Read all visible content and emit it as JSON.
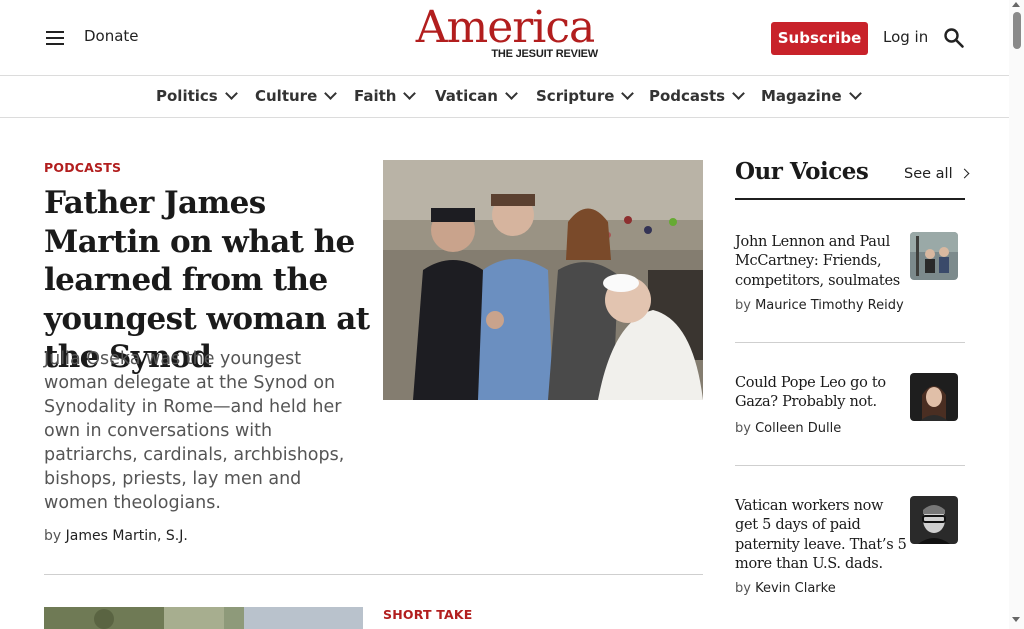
{
  "header": {
    "donate": "Donate",
    "logo_word": "America",
    "logo_sub": "THE JESUIT REVIEW",
    "subscribe": "Subscribe",
    "login": "Log in",
    "menu_icon": "hamburger-menu-icon",
    "search_icon": "search-icon"
  },
  "nav": {
    "items": [
      {
        "label": "Politics"
      },
      {
        "label": "Culture"
      },
      {
        "label": "Faith"
      },
      {
        "label": "Vatican"
      },
      {
        "label": "Scripture"
      },
      {
        "label": "Podcasts"
      },
      {
        "label": "Magazine"
      }
    ]
  },
  "main": {
    "kicker": "PODCASTS",
    "headline": "Father James Martin on what he learned from the youngest woman at the Synod",
    "dek": "Julia Oseka was the youngest woman delegate at the Synod on Synodality in Rome—and held her own in conversations with patriarchs, cardinals, archbishops, bishops, priests, lay men and women theologians.",
    "by_prefix": "by",
    "author": "James Martin, S.J.",
    "next_kicker": "SHORT TAKE"
  },
  "sidebar": {
    "title": "Our Voices",
    "see_all": "See all",
    "items": [
      {
        "title": "John Lennon and Paul McCartney: Friends, competitors, soulmates",
        "by": "by",
        "author": "Maurice Timothy Reidy"
      },
      {
        "title": "Could Pope Leo go to Gaza? Probably not.",
        "by": "by",
        "author": "Colleen Dulle"
      },
      {
        "title": "Vatican workers now get 5 days of paid paternity leave. That’s 5 more than U.S. dads.",
        "by": "by",
        "author": "Kevin Clarke"
      }
    ]
  },
  "colors": {
    "brand_red": "#b21e1e",
    "subscribe_bg": "#c8222a"
  }
}
